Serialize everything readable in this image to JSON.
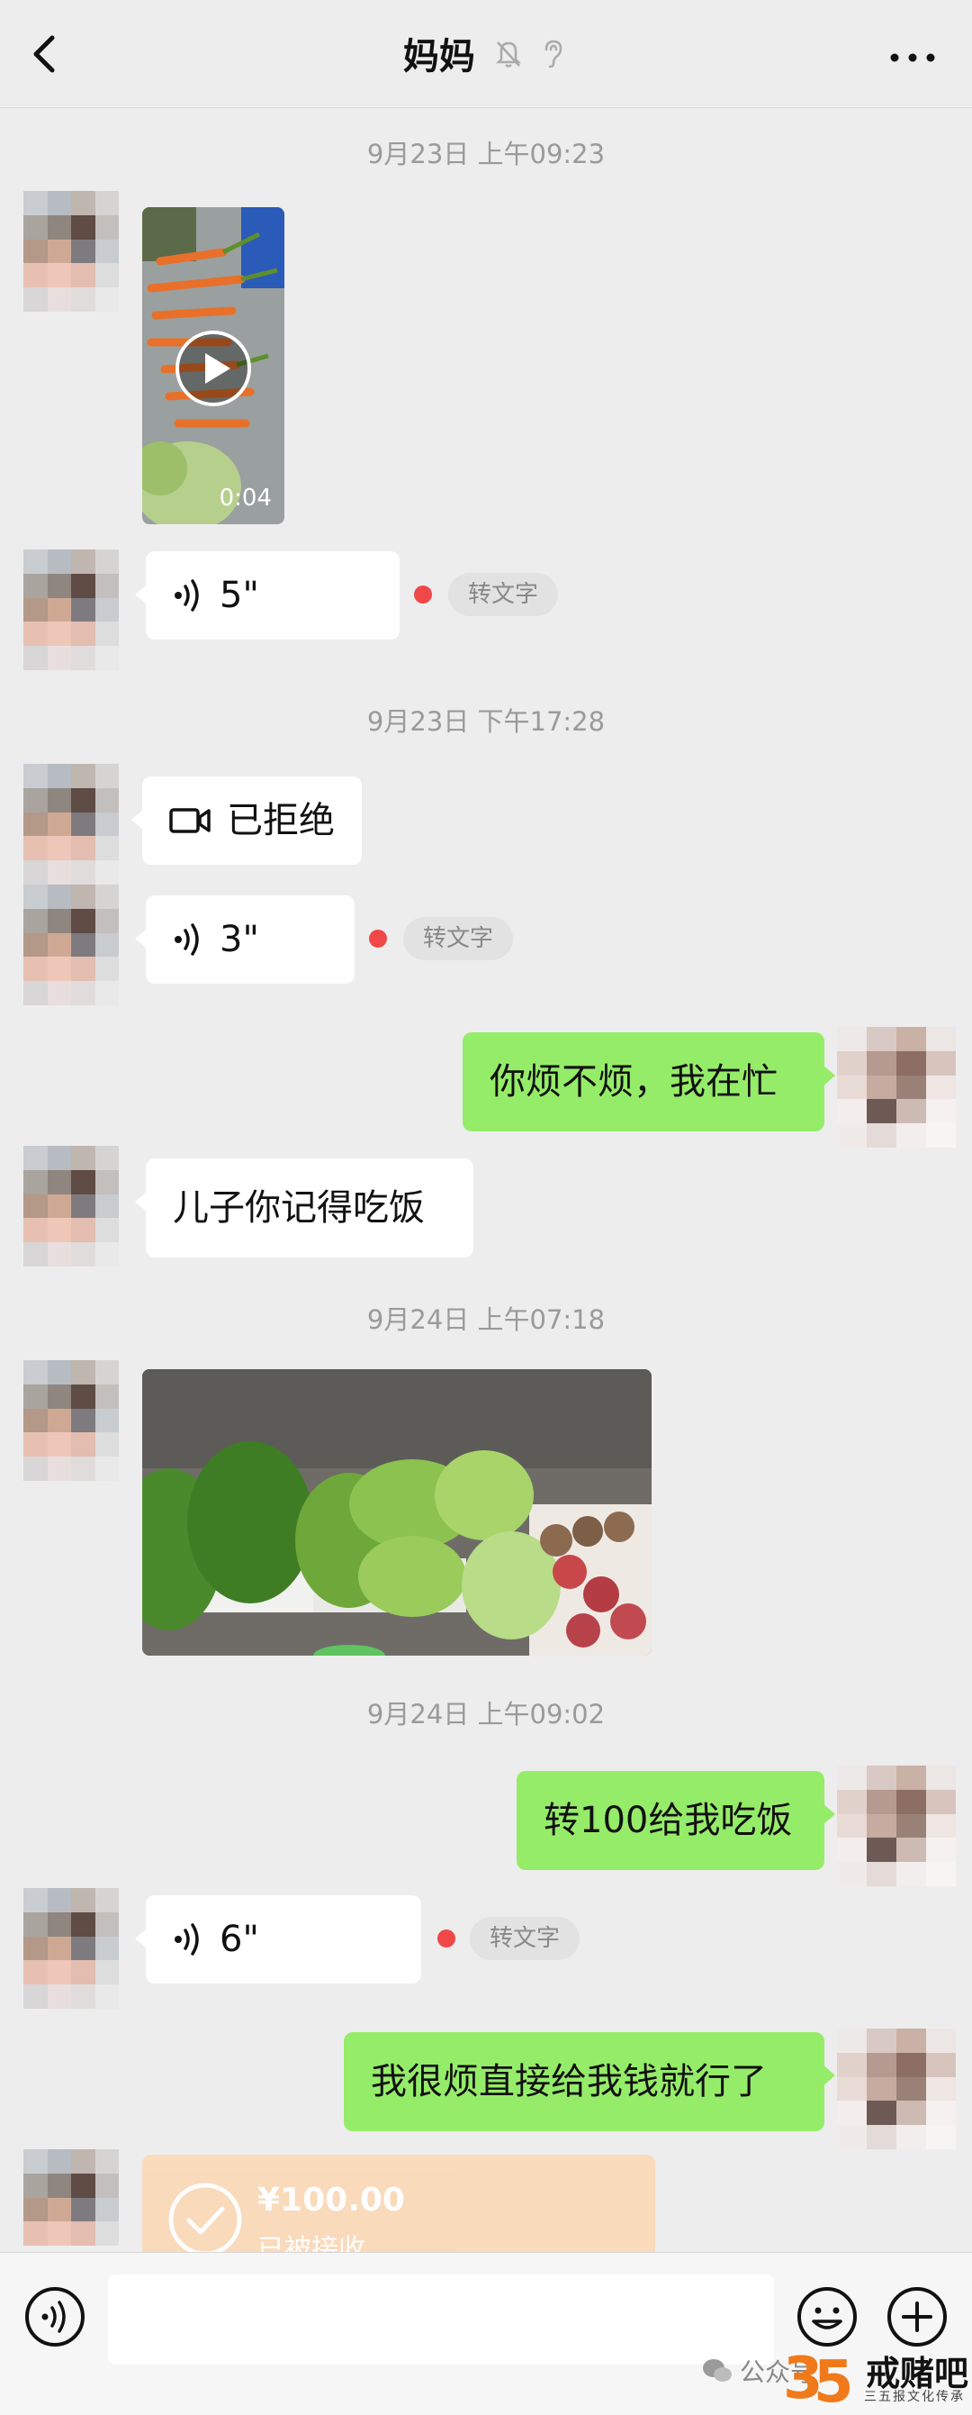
{
  "header": {
    "title": "妈妈"
  },
  "timestamps": [
    "9月23日 上午09:23",
    "9月23日 下午17:28",
    "9月24日 上午07:18",
    "9月24日 上午09:02"
  ],
  "messages": {
    "video_duration": "0:04",
    "voice1_duration": "5\"",
    "voice2_duration": "3\"",
    "voice3_duration": "6\"",
    "convert_label": "转文字",
    "video_call_status": "已拒绝",
    "me1": "你烦不烦，我在忙",
    "mom1": "儿子你记得吃饭",
    "me2": "转100给我吃饭",
    "me3": "我很烦直接给我钱就行了"
  },
  "transfer": {
    "amount": "¥100.00",
    "status": "已被接收"
  },
  "input": {
    "placeholder": ""
  },
  "watermark": {
    "prefix": "公众号",
    "brand": "戒赌吧",
    "subtitle": "三五报文化传承"
  },
  "colors": {
    "background": "#ededed",
    "my_bubble": "#95ec69",
    "other_bubble": "#ffffff",
    "unread": "#f04848",
    "transfer": "#fbd9b7"
  },
  "icons": [
    "back-icon",
    "mute-bell-icon",
    "ear-icon",
    "more-icon",
    "play-icon",
    "voice-wave-icon",
    "video-call-icon",
    "check-icon",
    "voice-input-icon",
    "emoji-icon",
    "plus-icon",
    "wechat-icon"
  ]
}
